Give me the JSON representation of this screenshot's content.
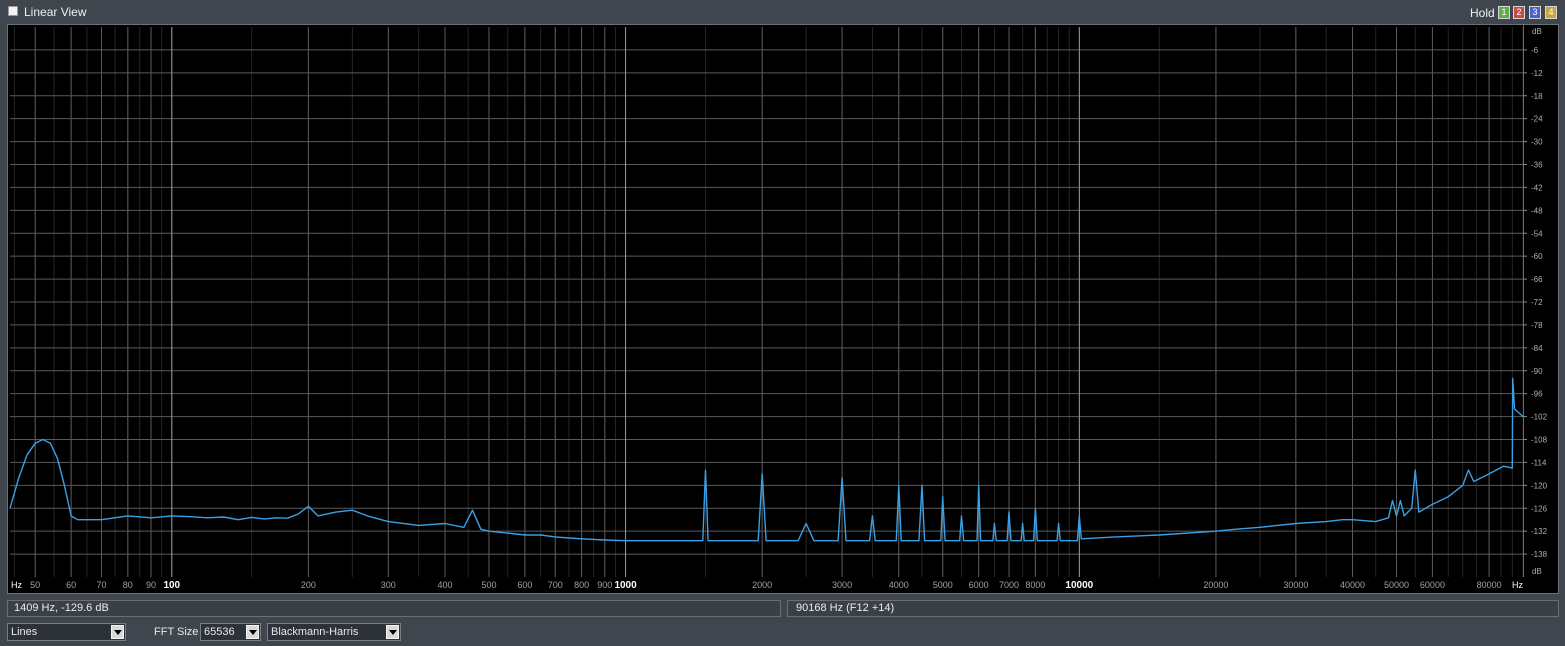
{
  "window": {
    "title": "Linear View",
    "hold_label": "Hold",
    "hold_buttons": [
      {
        "label": "1",
        "color": "#5fae4a"
      },
      {
        "label": "2",
        "color": "#c94a4a"
      },
      {
        "label": "3",
        "color": "#4a64c9"
      },
      {
        "label": "4",
        "color": "#c9a63a"
      }
    ]
  },
  "chart_data": {
    "type": "line",
    "x_scale": "log",
    "x_unit_label": "Hz",
    "y_unit_label": "dB",
    "xlim": [
      44,
      95000
    ],
    "ylim": [
      -144,
      0
    ],
    "x_ticks": [
      {
        "v": 50,
        "label": "50"
      },
      {
        "v": 60,
        "label": "60"
      },
      {
        "v": 70,
        "label": "70"
      },
      {
        "v": 80,
        "label": "80"
      },
      {
        "v": 90,
        "label": "90"
      },
      {
        "v": 100,
        "label": "100"
      },
      {
        "v": 200,
        "label": "200"
      },
      {
        "v": 300,
        "label": "300"
      },
      {
        "v": 400,
        "label": "400"
      },
      {
        "v": 500,
        "label": "500"
      },
      {
        "v": 600,
        "label": "600"
      },
      {
        "v": 700,
        "label": "700"
      },
      {
        "v": 800,
        "label": "800"
      },
      {
        "v": 900,
        "label": "900"
      },
      {
        "v": 1000,
        "label": "1000"
      },
      {
        "v": 2000,
        "label": "2000"
      },
      {
        "v": 3000,
        "label": "3000"
      },
      {
        "v": 4000,
        "label": "4000"
      },
      {
        "v": 5000,
        "label": "5000"
      },
      {
        "v": 6000,
        "label": "6000"
      },
      {
        "v": 7000,
        "label": "7000"
      },
      {
        "v": 8000,
        "label": "8000"
      },
      {
        "v": 10000,
        "label": "10000"
      },
      {
        "v": 20000,
        "label": "20000"
      },
      {
        "v": 30000,
        "label": "30000"
      },
      {
        "v": 40000,
        "label": "40000"
      },
      {
        "v": 50000,
        "label": "50000"
      },
      {
        "v": 60000,
        "label": "60000"
      },
      {
        "v": 80000,
        "label": "80000"
      }
    ],
    "y_ticks": [
      {
        "v": -6,
        "label": "-6"
      },
      {
        "v": -12,
        "label": "-12"
      },
      {
        "v": -18,
        "label": "-18"
      },
      {
        "v": -24,
        "label": "-24"
      },
      {
        "v": -30,
        "label": "-30"
      },
      {
        "v": -36,
        "label": "-36"
      },
      {
        "v": -42,
        "label": "-42"
      },
      {
        "v": -48,
        "label": "-48"
      },
      {
        "v": -54,
        "label": "-54"
      },
      {
        "v": -60,
        "label": "-60"
      },
      {
        "v": -66,
        "label": "-66"
      },
      {
        "v": -72,
        "label": "-72"
      },
      {
        "v": -78,
        "label": "-78"
      },
      {
        "v": -84,
        "label": "-84"
      },
      {
        "v": -90,
        "label": "-90"
      },
      {
        "v": -96,
        "label": "-96"
      },
      {
        "v": -102,
        "label": "-102"
      },
      {
        "v": -108,
        "label": "-108"
      },
      {
        "v": -114,
        "label": "-114"
      },
      {
        "v": -120,
        "label": "-120"
      },
      {
        "v": -126,
        "label": "-126"
      },
      {
        "v": -132,
        "label": "-132"
      },
      {
        "v": -138,
        "label": "-138"
      }
    ],
    "grid": true,
    "series": [
      {
        "color": "#3aa0e6",
        "points": [
          [
            44,
            -126
          ],
          [
            46,
            -118
          ],
          [
            48,
            -112
          ],
          [
            50,
            -109
          ],
          [
            52,
            -108
          ],
          [
            54,
            -109
          ],
          [
            56,
            -113
          ],
          [
            58,
            -120
          ],
          [
            60,
            -128
          ],
          [
            62,
            -129
          ],
          [
            70,
            -129
          ],
          [
            80,
            -128
          ],
          [
            90,
            -128.5
          ],
          [
            100,
            -128
          ],
          [
            110,
            -128.2
          ],
          [
            120,
            -128.5
          ],
          [
            130,
            -128.3
          ],
          [
            140,
            -129
          ],
          [
            150,
            -128.4
          ],
          [
            160,
            -128.8
          ],
          [
            170,
            -128.5
          ],
          [
            180,
            -128.6
          ],
          [
            190,
            -127.5
          ],
          [
            200,
            -125.5
          ],
          [
            210,
            -128
          ],
          [
            230,
            -127
          ],
          [
            250,
            -126.5
          ],
          [
            270,
            -128
          ],
          [
            300,
            -129.5
          ],
          [
            350,
            -130.5
          ],
          [
            400,
            -130
          ],
          [
            440,
            -131
          ],
          [
            460,
            -126.5
          ],
          [
            480,
            -131.5
          ],
          [
            500,
            -132
          ],
          [
            550,
            -132.5
          ],
          [
            600,
            -133
          ],
          [
            650,
            -133
          ],
          [
            700,
            -133.5
          ],
          [
            750,
            -133.8
          ],
          [
            800,
            -134
          ],
          [
            900,
            -134.3
          ],
          [
            1000,
            -134.5
          ],
          [
            1200,
            -134.5
          ],
          [
            1400,
            -134.5
          ],
          [
            1480,
            -134.5
          ],
          [
            1500,
            -116
          ],
          [
            1520,
            -134.5
          ],
          [
            1800,
            -134.5
          ],
          [
            1960,
            -134.5
          ],
          [
            2000,
            -117
          ],
          [
            2040,
            -134.5
          ],
          [
            2400,
            -134.5
          ],
          [
            2500,
            -130
          ],
          [
            2600,
            -134.5
          ],
          [
            2940,
            -134.5
          ],
          [
            3000,
            -118
          ],
          [
            3060,
            -134.5
          ],
          [
            3450,
            -134.5
          ],
          [
            3500,
            -128
          ],
          [
            3550,
            -134.5
          ],
          [
            3950,
            -134.5
          ],
          [
            4000,
            -120
          ],
          [
            4050,
            -134.5
          ],
          [
            4430,
            -134.5
          ],
          [
            4500,
            -120
          ],
          [
            4560,
            -134.5
          ],
          [
            4950,
            -134.5
          ],
          [
            5000,
            -123
          ],
          [
            5060,
            -134.5
          ],
          [
            5450,
            -134.5
          ],
          [
            5500,
            -128
          ],
          [
            5560,
            -134.5
          ],
          [
            5950,
            -134.5
          ],
          [
            6000,
            -120
          ],
          [
            6060,
            -134.5
          ],
          [
            6450,
            -134.5
          ],
          [
            6500,
            -130
          ],
          [
            6560,
            -134.5
          ],
          [
            6930,
            -134.5
          ],
          [
            7000,
            -127
          ],
          [
            7070,
            -134.5
          ],
          [
            7440,
            -134.5
          ],
          [
            7500,
            -130
          ],
          [
            7560,
            -134.5
          ],
          [
            7930,
            -134.5
          ],
          [
            8000,
            -126
          ],
          [
            8080,
            -134.5
          ],
          [
            8930,
            -134.5
          ],
          [
            9000,
            -130
          ],
          [
            9080,
            -134.5
          ],
          [
            9900,
            -134.5
          ],
          [
            10000,
            -128
          ],
          [
            10100,
            -134
          ],
          [
            12000,
            -133.5
          ],
          [
            15000,
            -133
          ],
          [
            20000,
            -132
          ],
          [
            22000,
            -131.5
          ],
          [
            25000,
            -131
          ],
          [
            30000,
            -130
          ],
          [
            35000,
            -129.5
          ],
          [
            38000,
            -129
          ],
          [
            40000,
            -129
          ],
          [
            45000,
            -129.5
          ],
          [
            48000,
            -128.5
          ],
          [
            49000,
            -124
          ],
          [
            50000,
            -128
          ],
          [
            51000,
            -124
          ],
          [
            52000,
            -128
          ],
          [
            54000,
            -126
          ],
          [
            55000,
            -116
          ],
          [
            56000,
            -127
          ],
          [
            60000,
            -125
          ],
          [
            65000,
            -123
          ],
          [
            70000,
            -120
          ],
          [
            72000,
            -116
          ],
          [
            74000,
            -119
          ],
          [
            80000,
            -117
          ],
          [
            86000,
            -115
          ],
          [
            90000,
            -115.5
          ],
          [
            90168,
            -92
          ],
          [
            91000,
            -100
          ],
          [
            95000,
            -102
          ]
        ]
      }
    ]
  },
  "status": {
    "cursor_readout": "1409 Hz, -129.6 dB",
    "peak_readout": "90168 Hz (F12 +14)"
  },
  "controls": {
    "display_mode": "Lines",
    "fft_label": "FFT Size",
    "fft_size": "65536",
    "window_function": "Blackmann-Harris"
  }
}
